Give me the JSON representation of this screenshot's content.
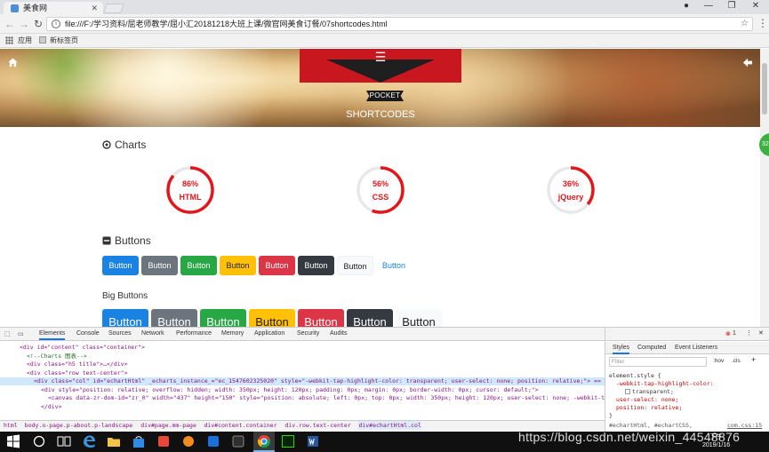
{
  "browser": {
    "tab_title": "美食网",
    "url": "file:///F:/学习资料/屈老师教学/屈小汇20181218大班上课/微官网美食订餐/07shortcodes.html",
    "bookmarks": [
      "应用",
      "新标签页"
    ]
  },
  "hero": {
    "pocket": "POCKET",
    "subtitle": "SHORTCODES"
  },
  "charts_section": {
    "title": "Charts",
    "chart_data": {
      "type": "progress-ring",
      "series": [
        {
          "label": "HTML",
          "value": 86,
          "display": "86%"
        },
        {
          "label": "CSS",
          "value": 56,
          "display": "56%"
        },
        {
          "label": "jQuery",
          "value": 36,
          "display": "36%"
        }
      ],
      "color": "#e3161b"
    }
  },
  "buttons_section": {
    "title": "Buttons",
    "buttons": [
      {
        "label": "Button",
        "color": "#1a82e2"
      },
      {
        "label": "Button",
        "color": "#6c757d"
      },
      {
        "label": "Button",
        "color": "#28a745"
      },
      {
        "label": "Button",
        "color": "#ffc107"
      },
      {
        "label": "Button",
        "color": "#dc3545"
      },
      {
        "label": "Button",
        "color": "#343a40"
      },
      {
        "label": "Button",
        "color": "#f8f9fa"
      },
      {
        "label": "Button",
        "color": "#1a82e2"
      }
    ],
    "big_title": "Big Buttons",
    "big_buttons": [
      "Button",
      "Button",
      "Button",
      "Button",
      "Button",
      "Button",
      "Button"
    ]
  },
  "devtools": {
    "tabs": [
      "Elements",
      "Console",
      "Sources",
      "Network",
      "Performance",
      "Memory",
      "Application",
      "Security",
      "Audits"
    ],
    "error_count": "1",
    "side_tabs": [
      "Styles",
      "Computed",
      "Event Listeners"
    ],
    "filter_placeholder": "Filter",
    "hov": ":hov",
    "cls": ".cls",
    "code_lines": [
      "<div id=\"content\" class=\"container\">",
      "<!--Charts 图表-->",
      "<div class=\"h5 title\">…</div>",
      "<div class=\"row text-center\">",
      "<div class=\"col\" id=\"echartHtml\" _echarts_instance_=\"ec_1547602325020\" style=\"-webkit-tap-highlight-color: transparent; user-select: none; position: relative;\"> == $0",
      "<div style=\"position: relative; overflow: hidden; width: 350px; height: 120px; padding: 0px; margin: 0px; border-width: 0px; cursor: default;\">",
      "<canvas data-zr-dom-id=\"zr_0\" width=\"437\" height=\"150\" style=\"position: absolute; left: 0px; top: 0px; width: 350px; height: 120px; user-select: none; -webkit-tap-highlight-color: rgba(0, 0, 0, 0); padding: 0px; margin: 0px; border-width: 0px;\">",
      "</div>"
    ],
    "crumbs": [
      "html",
      "body.o-page.p-about.p-landscape",
      "div#page.mm-page",
      "div#content.container",
      "div.row.text-center",
      "div#echartHtml.col"
    ],
    "styles": {
      "selector": "element.style {",
      "props": [
        "-webkit-tap-highlight-color:",
        "transparent;",
        "user-select: none;",
        "position: relative;"
      ],
      "close": "}",
      "next_selector": "#echartHtml, #echartCSS,",
      "source": "com.css:15"
    }
  },
  "taskbar": {
    "time": "下午",
    "date": "2019/1/16"
  },
  "watermark": "https://blog.csdn.net/weixin_44548876"
}
